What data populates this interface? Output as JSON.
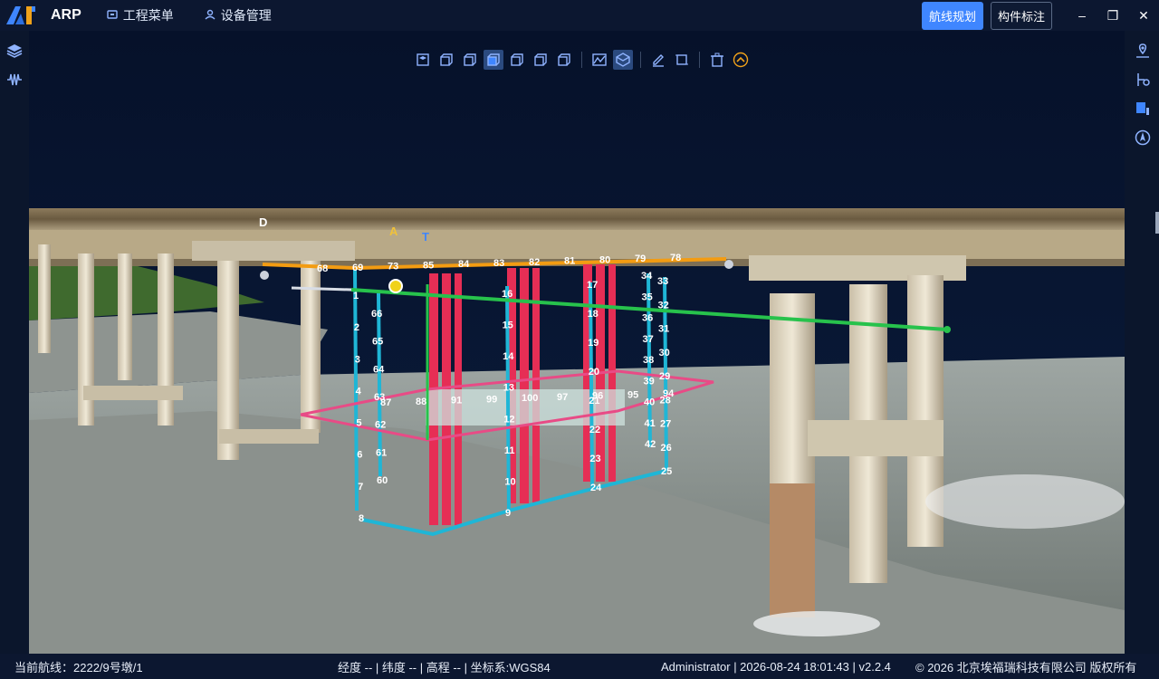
{
  "app": {
    "name": "ARP"
  },
  "menu": {
    "project": "工程菜单",
    "device": "设备管理"
  },
  "actions": {
    "route_plan": "航线规划",
    "component_mark": "构件标注"
  },
  "window": {
    "minimize": "–",
    "maximize": "❐",
    "close": "✕"
  },
  "status": {
    "route_label": "当前航线：",
    "route_value": "2222/9号墩/1",
    "coords": "经度 -- | 纬度 -- | 高程 -- | 坐标系:WGS84",
    "user_info": "Administrator | 2026-08-24 18:01:43 | v2.2.4",
    "copyright": "© 2026 北京埃福瑞科技有限公司 版权所有"
  },
  "markers": {
    "d": "D",
    "a": "A",
    "t": "T"
  },
  "waypoints": {
    "top_row": [
      "68",
      "69",
      "73",
      "85",
      "84",
      "83",
      "82",
      "81",
      "80",
      "79",
      "78"
    ],
    "left_col_1": [
      "1",
      "2",
      "3",
      "4",
      "5",
      "6",
      "7",
      "8"
    ],
    "left_col_2": [
      "66",
      "65",
      "64",
      "63",
      "62",
      "61",
      "60"
    ],
    "mid_col": [
      "16",
      "15",
      "14",
      "13",
      "12",
      "11",
      "10",
      "9"
    ],
    "right_col_1": [
      "17",
      "18",
      "19",
      "20",
      "21",
      "22",
      "23",
      "24"
    ],
    "right_col_2": [
      "34",
      "35",
      "36",
      "37",
      "38",
      "39",
      "40",
      "41",
      "42"
    ],
    "right_col_3": [
      "33",
      "32",
      "31",
      "30",
      "29",
      "28",
      "27",
      "26",
      "25"
    ],
    "pink_labels": [
      "87",
      "88",
      "91",
      "99",
      "100",
      "97",
      "96",
      "95",
      "94"
    ]
  },
  "colors": {
    "accent": "#3f86ff",
    "sky": "#08142b",
    "route_blue": "#1fb6d6",
    "route_pink": "#e84b86",
    "route_orange": "#f39c12",
    "route_green": "#27c24c",
    "pier_red": "#e62e55"
  }
}
